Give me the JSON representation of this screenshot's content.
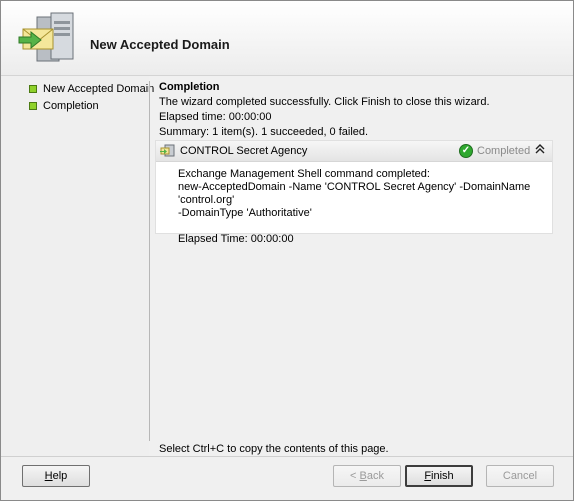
{
  "window": {
    "title": "New Accepted Domain"
  },
  "nav": {
    "items": [
      {
        "label": "New Accepted Domain",
        "status": "completed"
      },
      {
        "label": "Completion",
        "status": "completed"
      }
    ]
  },
  "content": {
    "heading": "Completion",
    "message": "The wizard completed successfully. Click Finish to close this wizard.",
    "elapsed": "Elapsed time: 00:00:00",
    "summary": "Summary: 1 item(s). 1 succeeded, 0 failed."
  },
  "result": {
    "title": "CONTROL Secret Agency",
    "status": "Completed",
    "lines": [
      "Exchange Management Shell command completed:",
      "new-AcceptedDomain -Name 'CONTROL Secret Agency' -DomainName 'control.org'",
      "-DomainType 'Authoritative'"
    ],
    "elapsed": "Elapsed Time: 00:00:00"
  },
  "hint": "Select Ctrl+C to copy the contents of this page.",
  "buttons": {
    "help": {
      "label_underline": "H",
      "label_rest": "elp"
    },
    "back": {
      "label_prefix": "< ",
      "label_underline": "B",
      "label_rest": "ack"
    },
    "finish": {
      "label_underline": "F",
      "label_rest": "inish"
    },
    "cancel": {
      "label": "Cancel"
    }
  },
  "colors": {
    "nav_bullet": "#8fd12a",
    "status_ok": "#2fa82f"
  },
  "icons": {
    "header": "exchange-server-icon",
    "result": "domain-icon",
    "status": "check-icon",
    "collapse": "double-chevron-up-icon"
  }
}
